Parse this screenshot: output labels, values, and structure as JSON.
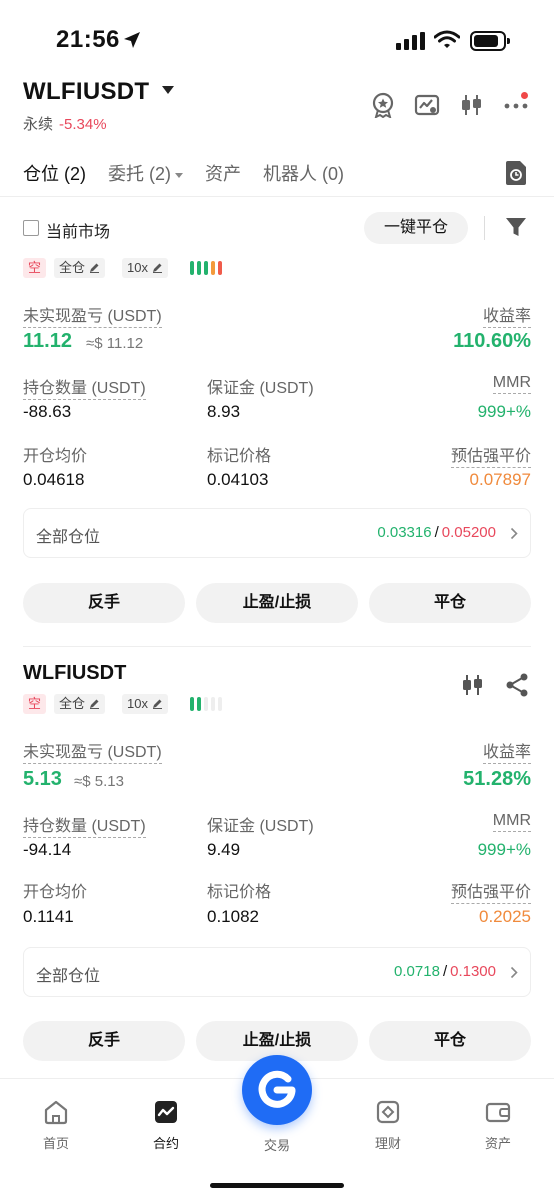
{
  "status_bar": {
    "time": "21:56"
  },
  "header": {
    "pair": "WLFIUSDT",
    "type": "永续",
    "change": "-5.34%"
  },
  "tabs": [
    {
      "label": "仓位 (2)",
      "active": true
    },
    {
      "label": "委托 (2)",
      "active": false
    },
    {
      "label": "资产",
      "active": false
    },
    {
      "label": "机器人 (0)",
      "active": false
    }
  ],
  "filter": {
    "current_market_label": "当前市场",
    "close_all_label": "一键平仓"
  },
  "labels": {
    "upnl": "未实现盈亏 (USDT)",
    "roe": "收益率",
    "size": "持仓数量 (USDT)",
    "margin": "保证金 (USDT)",
    "mmr": "MMR",
    "entry": "开仓均价",
    "mark": "标记价格",
    "liq": "预估强平价",
    "all_positions": "全部仓位",
    "reverse": "反手",
    "tpsl": "止盈/止损",
    "close": "平仓"
  },
  "positions": [
    {
      "title": "WLFIUSDT",
      "side": "空",
      "margin_mode": "全仓",
      "leverage": "10x",
      "risk_level": 5,
      "upnl": "11.12",
      "upnl_usd": "≈$ 11.12",
      "roe": "110.60%",
      "size": "-88.63",
      "margin": "8.93",
      "mmr": "999+%",
      "entry": "0.04618",
      "mark": "0.04103",
      "liq": "0.07897",
      "tp": "0.03316",
      "sl": "0.05200"
    },
    {
      "title": "WLFIUSDT",
      "side": "空",
      "margin_mode": "全仓",
      "leverage": "10x",
      "risk_level": 2,
      "upnl": "5.13",
      "upnl_usd": "≈$ 5.13",
      "roe": "51.28%",
      "size": "-94.14",
      "margin": "9.49",
      "mmr": "999+%",
      "entry": "0.1141",
      "mark": "0.1082",
      "liq": "0.2025",
      "tp": "0.0718",
      "sl": "0.1300"
    }
  ],
  "bottom_nav": [
    {
      "label": "首页",
      "icon": "home-icon"
    },
    {
      "label": "合约",
      "icon": "futures-icon",
      "active": true
    },
    {
      "label": "交易",
      "icon": "trade-icon"
    },
    {
      "label": "理财",
      "icon": "earn-icon"
    },
    {
      "label": "资产",
      "icon": "wallet-icon"
    }
  ],
  "colors": {
    "green": "#23b26d",
    "red": "#e8485c",
    "orange": "#f08a3c",
    "brand": "#1f6cf5"
  }
}
